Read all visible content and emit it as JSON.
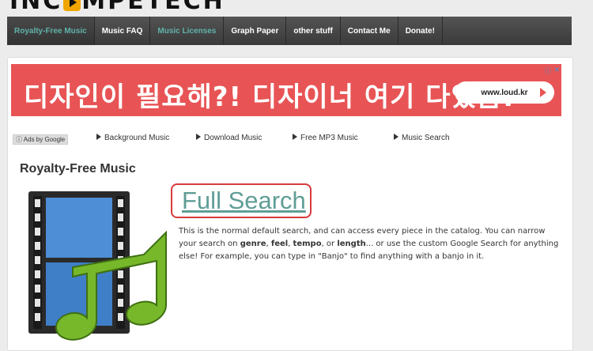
{
  "header": {
    "logo_left": "INC",
    "logo_right": "MPETECH"
  },
  "nav": [
    {
      "label": "Royalty-Free Music",
      "style": "teal-active"
    },
    {
      "label": "Music FAQ"
    },
    {
      "label": "Music Licenses",
      "style": "teal"
    },
    {
      "label": "Graph Paper"
    },
    {
      "label": "other stuff"
    },
    {
      "label": "Contact Me"
    },
    {
      "label": "Donate!"
    }
  ],
  "ad": {
    "headline": "디자인이 필요해?! 디자이너 여기 다있음!",
    "button_label": "www.loud.kr",
    "color": "#e85455"
  },
  "ads_bar": {
    "label": "Ads by Google",
    "links": [
      "Background Music",
      "Download Music",
      "Free MP3 Music",
      "Music Search"
    ]
  },
  "main": {
    "title": "Royalty-Free Music",
    "full_search_link": "Full Search",
    "desc_1": "This is the normal default search, and can access every piece in the catalog. You can narrow your search on ",
    "desc_genre": "genre",
    "desc_sep1": ", ",
    "desc_feel": "feel",
    "desc_sep2": ", ",
    "desc_tempo": "tempo",
    "desc_sep3": ", or ",
    "desc_length": "length",
    "desc_2": "... or use the custom Google Search for anything else! For example, you can type in \"Banjo\" to find anything with a banjo in it."
  },
  "colors": {
    "accent": "#5f9e96",
    "highlight": "#d73b3b",
    "nav": "#444444"
  }
}
